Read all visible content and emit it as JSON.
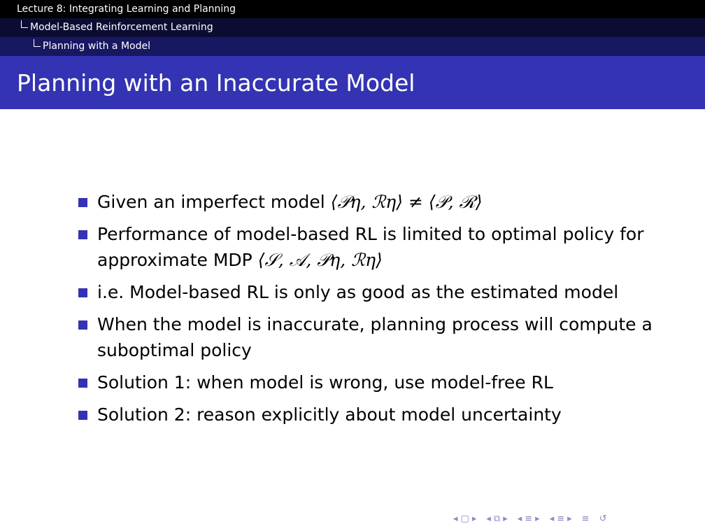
{
  "header": {
    "line1": "Lecture 8: Integrating Learning and Planning",
    "line2": "Model-Based Reinforcement Learning",
    "line3": "Planning with a Model"
  },
  "slide": {
    "title": "Planning with an Inaccurate Model",
    "bullets": [
      {
        "text": "Given an imperfect model ",
        "math": "⟨𝒫η, ℛη⟩ ≠ ⟨𝒫, ℛ⟩"
      },
      {
        "text": "Performance of model-based RL is limited to optimal policy for approximate MDP ",
        "math": "⟨𝒮, 𝒜, 𝒫η, ℛη⟩"
      },
      {
        "text": "i.e. Model-based RL is only as good as the estimated model"
      },
      {
        "text": "When the model is inaccurate, planning process will compute a suboptimal policy"
      },
      {
        "text": "Solution 1: when model is wrong, use model-free RL"
      },
      {
        "text": "Solution 2: reason explicitly about model uncertainty"
      }
    ]
  },
  "nav": {
    "icons": [
      "◂",
      "▢",
      "▸",
      "◂",
      "⧉",
      "▸",
      "◂",
      "≡",
      "▸",
      "◂",
      "≡",
      "▸",
      "≡",
      "↺"
    ],
    "color": "#8a8ac9"
  },
  "colors": {
    "accent": "#3333b3",
    "header_dark": "#000000",
    "header_mid": "#0c0c33",
    "header_light": "#181862"
  }
}
